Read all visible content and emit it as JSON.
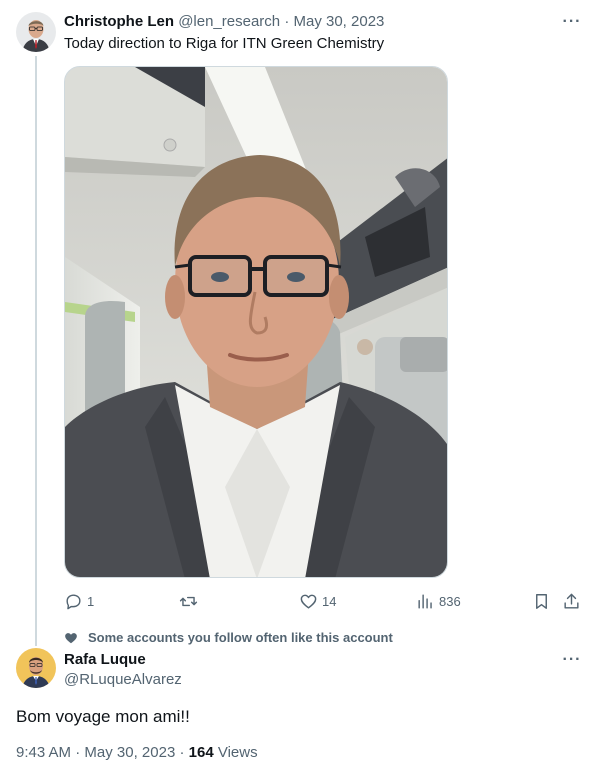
{
  "original_tweet": {
    "author_name": "Christophe Len",
    "handle": "@len_research",
    "separator": "·",
    "date": "May 30, 2023",
    "text": "Today direction to Riga for ITN Green Chemistry",
    "more_label": "···",
    "media_icon": "airplane-selfie-photo",
    "stats": {
      "replies": "1",
      "retweets": "",
      "likes": "14",
      "views": "836"
    }
  },
  "social_context": {
    "icon": "heart-icon",
    "text": "Some accounts you follow often like this account"
  },
  "reply_tweet": {
    "author_name": "Rafa Luque",
    "handle": "@RLuqueAlvarez",
    "more_label": "···",
    "text": "Bom voyage mon ami!!",
    "time": "9:43 AM",
    "separator": "·",
    "date": "May 30, 2023",
    "separator2": "·",
    "views_count": "164",
    "views_label": "Views"
  },
  "colors": {
    "text_primary": "#0f1419",
    "text_secondary": "#536471",
    "thread_line": "#cfd9de"
  }
}
